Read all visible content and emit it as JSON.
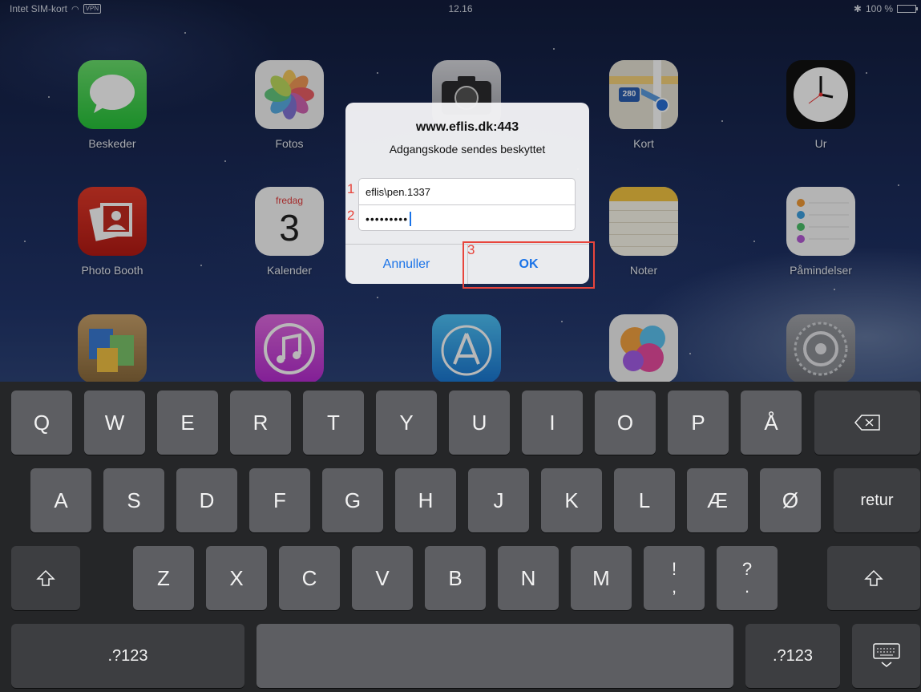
{
  "status_bar": {
    "carrier": "Intet SIM-kort",
    "vpn": "VPN",
    "time": "12.16",
    "battery": "100 %",
    "battery_level": 1.0
  },
  "home_apps": [
    {
      "label": "Beskeder",
      "icon": "messages-icon"
    },
    {
      "label": "Fotos",
      "icon": "photos-icon"
    },
    {
      "label": "",
      "icon": "camera-icon"
    },
    {
      "label": "Kort",
      "icon": "maps-icon"
    },
    {
      "label": "Ur",
      "icon": "clock-icon"
    },
    {
      "label": "Photo Booth",
      "icon": "photo-booth-icon"
    },
    {
      "label": "Kalender",
      "icon": "calendar-icon"
    },
    {
      "label": "Noter",
      "icon": "notes-icon"
    },
    {
      "label": "Påmindelser",
      "icon": "reminders-icon"
    },
    {
      "label": "",
      "icon": "newsstand-icon"
    },
    {
      "label": "",
      "icon": "itunes-store-icon"
    },
    {
      "label": "",
      "icon": "app-store-icon"
    },
    {
      "label": "",
      "icon": "game-center-icon"
    },
    {
      "label": "",
      "icon": "settings-icon"
    }
  ],
  "calendar_icon": {
    "weekday": "fredag",
    "day": "3"
  },
  "maps_icon": {
    "route": "280"
  },
  "alert": {
    "title": "www.eflis.dk:443",
    "message": "Adgangskode sendes beskyttet",
    "username": "eflis\\pen.1337",
    "password_masked": "•••••••••",
    "cancel_label": "Annuller",
    "ok_label": "OK"
  },
  "annotations": {
    "n1": "1",
    "n2": "2",
    "n3": "3"
  },
  "keyboard": {
    "row1": [
      "Q",
      "W",
      "E",
      "R",
      "T",
      "Y",
      "U",
      "I",
      "O",
      "P",
      "Å"
    ],
    "backspace_icon": "backspace-icon",
    "row2": [
      "A",
      "S",
      "D",
      "F",
      "G",
      "H",
      "J",
      "K",
      "L",
      "Æ",
      "Ø"
    ],
    "return_label": "retur",
    "shift_icon": "shift-icon",
    "row3": [
      "Z",
      "X",
      "C",
      "V",
      "B",
      "N",
      "M"
    ],
    "punct": [
      {
        "top": "!",
        "bottom": ","
      },
      {
        "top": "?",
        "bottom": "."
      }
    ],
    "numbers_label": ".?123",
    "hide_keyboard_icon": "keyboard-hide-icon"
  }
}
